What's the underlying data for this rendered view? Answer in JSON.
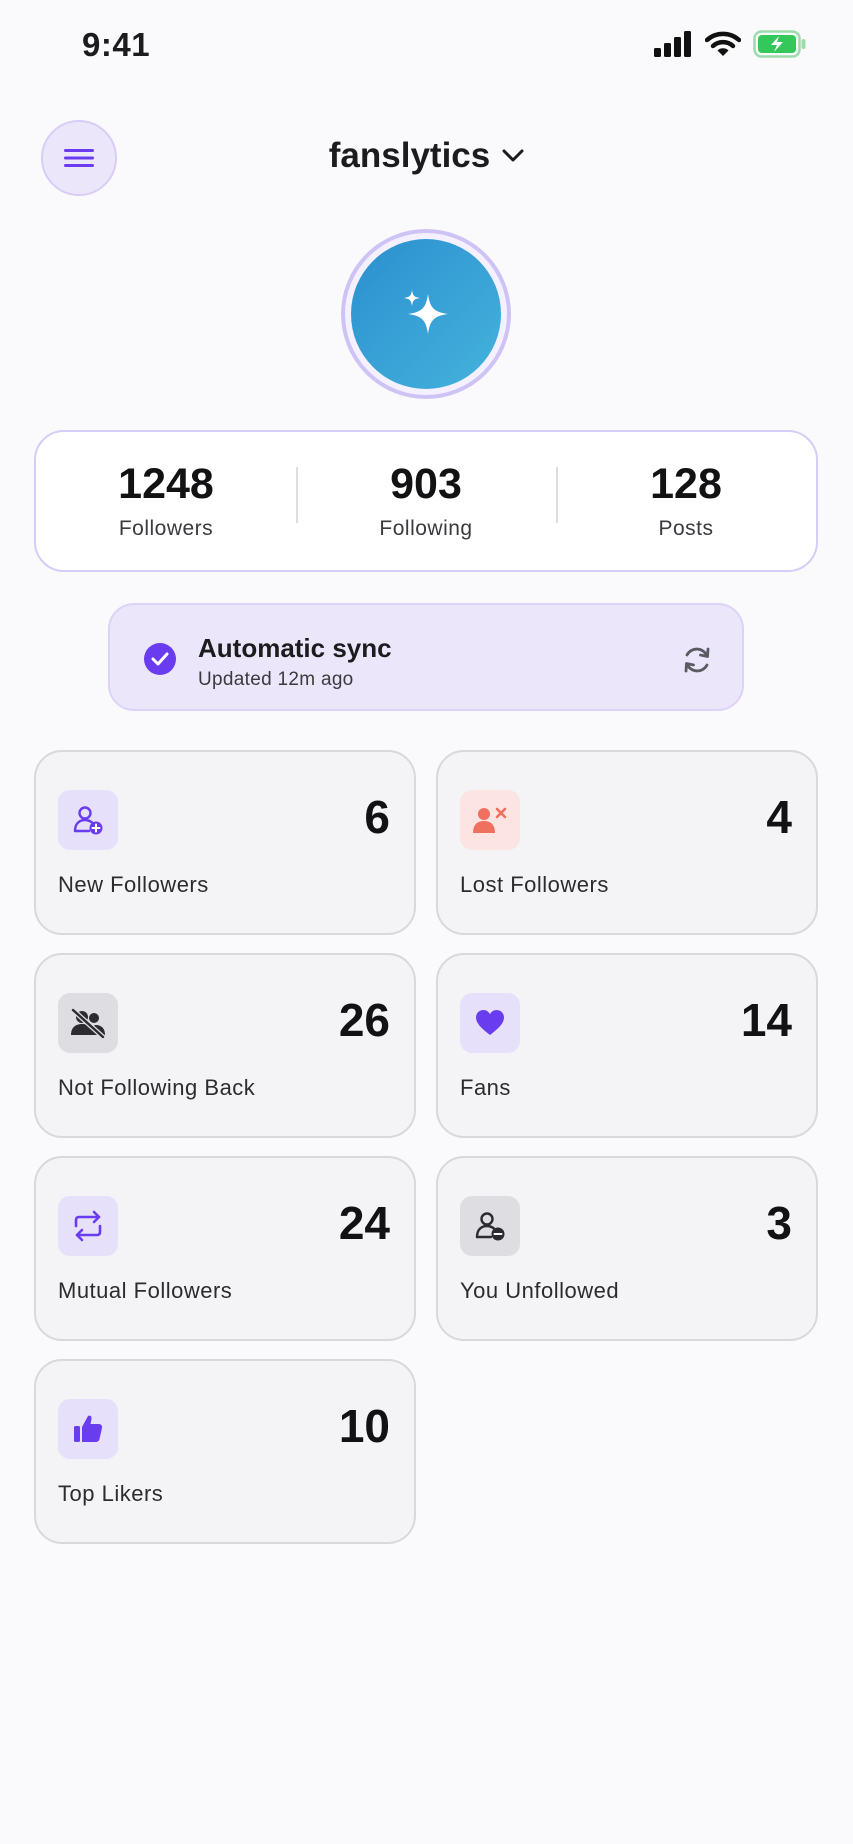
{
  "status_bar": {
    "time": "9:41"
  },
  "header": {
    "title": "fanslytics"
  },
  "stats": [
    {
      "value": "1248",
      "label": "Followers"
    },
    {
      "value": "903",
      "label": "Following"
    },
    {
      "value": "128",
      "label": "Posts"
    }
  ],
  "sync": {
    "title": "Automatic sync",
    "subtitle": "Updated 12m ago"
  },
  "cards": [
    {
      "count": "6",
      "label": "New Followers",
      "icon": "person-add-icon"
    },
    {
      "count": "4",
      "label": "Lost Followers",
      "icon": "person-remove-icon"
    },
    {
      "count": "26",
      "label": "Not Following Back",
      "icon": "people-crossed-icon"
    },
    {
      "count": "14",
      "label": "Fans",
      "icon": "heart-icon"
    },
    {
      "count": "24",
      "label": "Mutual Followers",
      "icon": "repeat-icon"
    },
    {
      "count": "3",
      "label": "You Unfollowed",
      "icon": "person-minus-icon"
    },
    {
      "count": "10",
      "label": "Top Likers",
      "icon": "thumbs-up-icon"
    }
  ],
  "colors": {
    "accent": "#6a3cf0",
    "accent_light": "#ece6fb",
    "danger": "#f0705f",
    "battery": "#34c759",
    "avatar_gradient": [
      "#2b8fcf",
      "#45b3dc"
    ]
  }
}
